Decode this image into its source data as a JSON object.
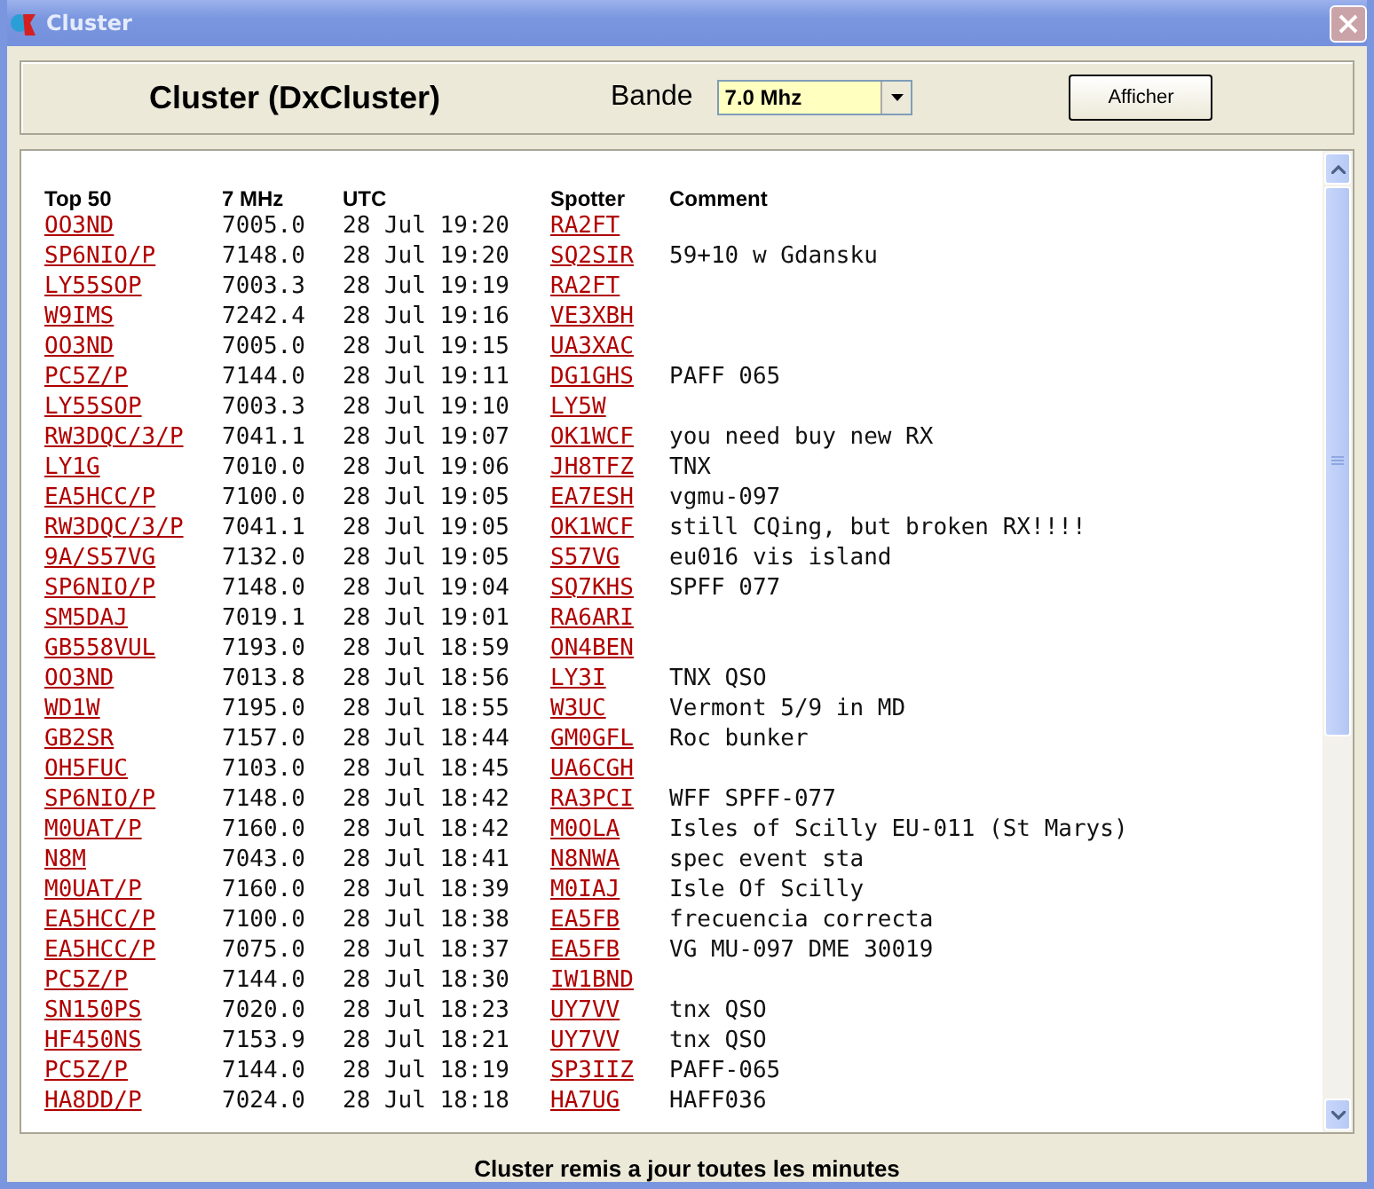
{
  "window": {
    "title": "Cluster"
  },
  "header": {
    "title": "Cluster (DxCluster)",
    "band_label": "Bande",
    "band_value": "7.0 Mhz",
    "button": "Afficher"
  },
  "table": {
    "columns": [
      "Top 50",
      "7 MHz",
      "UTC",
      "Spotter",
      "Comment"
    ],
    "rows": [
      {
        "call": "OO3ND",
        "freq": "7005.0",
        "utc": "28 Jul 19:20",
        "spotter": "RA2FT"
      },
      {
        "call": "SP6NIO/P",
        "freq": "7148.0",
        "utc": "28 Jul 19:20",
        "spotter": "SQ2SIR",
        "comment": "59+10 w Gdansku"
      },
      {
        "call": "LY55SOP",
        "freq": "7003.3",
        "utc": "28 Jul 19:19",
        "spotter": "RA2FT"
      },
      {
        "call": "W9IMS",
        "freq": "7242.4",
        "utc": "28 Jul 19:16",
        "spotter": "VE3XBH"
      },
      {
        "call": "OO3ND",
        "freq": "7005.0",
        "utc": "28 Jul 19:15",
        "spotter": "UA3XAC"
      },
      {
        "call": "PC5Z/P",
        "freq": "7144.0",
        "utc": "28 Jul 19:11",
        "spotter": "DG1GHS",
        "comment": "PAFF 065"
      },
      {
        "call": "LY55SOP",
        "freq": "7003.3",
        "utc": "28 Jul 19:10",
        "spotter": "LY5W"
      },
      {
        "call": "RW3DQC/3/P",
        "freq": "7041.1",
        "utc": "28 Jul 19:07",
        "spotter": "OK1WCF",
        "comment": "you need buy new RX"
      },
      {
        "call": "LY1G",
        "freq": "7010.0",
        "utc": "28 Jul 19:06",
        "spotter": "JH8TFZ",
        "comment": "TNX"
      },
      {
        "call": "EA5HCC/P",
        "freq": "7100.0",
        "utc": "28 Jul 19:05",
        "spotter": "EA7ESH",
        "comment": "vgmu-097"
      },
      {
        "call": "RW3DQC/3/P",
        "freq": "7041.1",
        "utc": "28 Jul 19:05",
        "spotter": "OK1WCF",
        "comment": "still CQing, but broken RX!!!!"
      },
      {
        "call": "9A/S57VG",
        "freq": "7132.0",
        "utc": "28 Jul 19:05",
        "spotter": "S57VG",
        "comment": "eu016 vis island"
      },
      {
        "call": "SP6NIO/P",
        "freq": "7148.0",
        "utc": "28 Jul 19:04",
        "spotter": "SQ7KHS",
        "comment": "SPFF 077"
      },
      {
        "call": "SM5DAJ",
        "freq": "7019.1",
        "utc": "28 Jul 19:01",
        "spotter": "RA6ARI"
      },
      {
        "call": "GB558VUL",
        "freq": "7193.0",
        "utc": "28 Jul 18:59",
        "spotter": "ON4BEN"
      },
      {
        "call": "OO3ND",
        "freq": "7013.8",
        "utc": "28 Jul 18:56",
        "spotter": "LY3I",
        "comment": "TNX QSO"
      },
      {
        "call": "WD1W",
        "freq": "7195.0",
        "utc": "28 Jul 18:55",
        "spotter": "W3UC",
        "comment": "Vermont 5/9 in MD"
      },
      {
        "call": "GB2SR",
        "freq": "7157.0",
        "utc": "28 Jul 18:44",
        "spotter": "GM0GFL",
        "comment": "Roc bunker"
      },
      {
        "call": "OH5FUC",
        "freq": "7103.0",
        "utc": "28 Jul 18:45",
        "spotter": "UA6CGH"
      },
      {
        "call": "SP6NIO/P",
        "freq": "7148.0",
        "utc": "28 Jul 18:42",
        "spotter": "RA3PCI",
        "comment": "WFF SPFF-077"
      },
      {
        "call": "M0UAT/P",
        "freq": "7160.0",
        "utc": "28 Jul 18:42",
        "spotter": "M0OLA",
        "comment": "Isles of Scilly EU-011 (St Marys)"
      },
      {
        "call": "N8M",
        "freq": "7043.0",
        "utc": "28 Jul 18:41",
        "spotter": "N8NWA",
        "comment": "spec event sta"
      },
      {
        "call": "M0UAT/P",
        "freq": "7160.0",
        "utc": "28 Jul 18:39",
        "spotter": "M0IAJ",
        "comment": "Isle Of Scilly"
      },
      {
        "call": "EA5HCC/P",
        "freq": "7100.0",
        "utc": "28 Jul 18:38",
        "spotter": "EA5FB",
        "comment": "frecuencia correcta"
      },
      {
        "call": "EA5HCC/P",
        "freq": "7075.0",
        "utc": "28 Jul 18:37",
        "spotter": "EA5FB",
        "comment": "VG MU-097 DME 30019"
      },
      {
        "call": "PC5Z/P",
        "freq": "7144.0",
        "utc": "28 Jul 18:30",
        "spotter": "IW1BND"
      },
      {
        "call": "SN150PS",
        "freq": "7020.0",
        "utc": "28 Jul 18:23",
        "spotter": "UY7VV",
        "comment": "tnx QSO"
      },
      {
        "call": "HF450NS",
        "freq": "7153.9",
        "utc": "28 Jul 18:21",
        "spotter": "UY7VV",
        "comment": "tnx QSO"
      },
      {
        "call": "PC5Z/P",
        "freq": "7144.0",
        "utc": "28 Jul 18:19",
        "spotter": "SP3IIZ",
        "comment": "PAFF-065"
      },
      {
        "call": "HA8DD/P",
        "freq": "7024.0",
        "utc": "28 Jul 18:18",
        "spotter": "HA7UG",
        "comment": "HAFF036"
      }
    ]
  },
  "status": "Cluster remis a jour toutes les minutes"
}
